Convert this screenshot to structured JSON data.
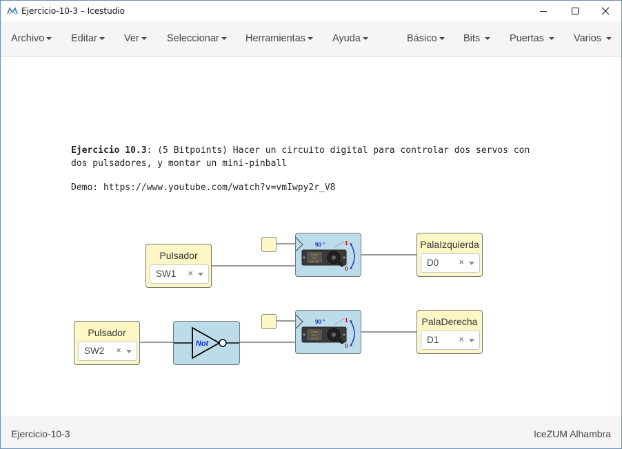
{
  "window": {
    "title": "Ejercicio-10-3 – Icestudio"
  },
  "menu": {
    "left": [
      "Archivo",
      "Editar",
      "Ver",
      "Seleccionar",
      "Herramientas",
      "Ayuda"
    ],
    "right": [
      "Básico",
      "Bits",
      "Puertas",
      "Varios"
    ]
  },
  "info": {
    "heading": "Ejercicio 10.3",
    "line1_rest": ": (5 Bitpoints) Hacer un circuito digital para controlar dos servos con",
    "line2": "dos pulsadores, y montar un mini-pinball",
    "demo": "Demo: https://www.youtube.com/watch?v=vmIwpy2r_V8"
  },
  "blocks": {
    "input1": {
      "label": "Pulsador",
      "pin": "SW1",
      "clear": "×"
    },
    "input2": {
      "label": "Pulsador",
      "pin": "SW2",
      "clear": "×"
    },
    "not_gate": {
      "label": "Not"
    },
    "servo1": {
      "angle": "90 °",
      "one": "1",
      "zero": "0",
      "brand": "Tower Pro SG90"
    },
    "servo2": {
      "angle": "90 °",
      "one": "1",
      "zero": "0",
      "brand": "Tower Pro SG90"
    },
    "output1": {
      "label": "PalaIzquierda",
      "pin": "D0",
      "clear": "×"
    },
    "output2": {
      "label": "PalaDerecha",
      "pin": "D1",
      "clear": "×"
    }
  },
  "status": {
    "left": "Ejercicio-10-3",
    "right": "IceZUM Alhambra"
  },
  "colors": {
    "io_block": "#fdf7c6",
    "logic_block": "#bcdcea",
    "wire": "#777777"
  },
  "icons": {
    "app": "icestudio-logo-icon",
    "minimize": "minimize-icon",
    "maximize": "maximize-icon",
    "close": "close-icon"
  }
}
